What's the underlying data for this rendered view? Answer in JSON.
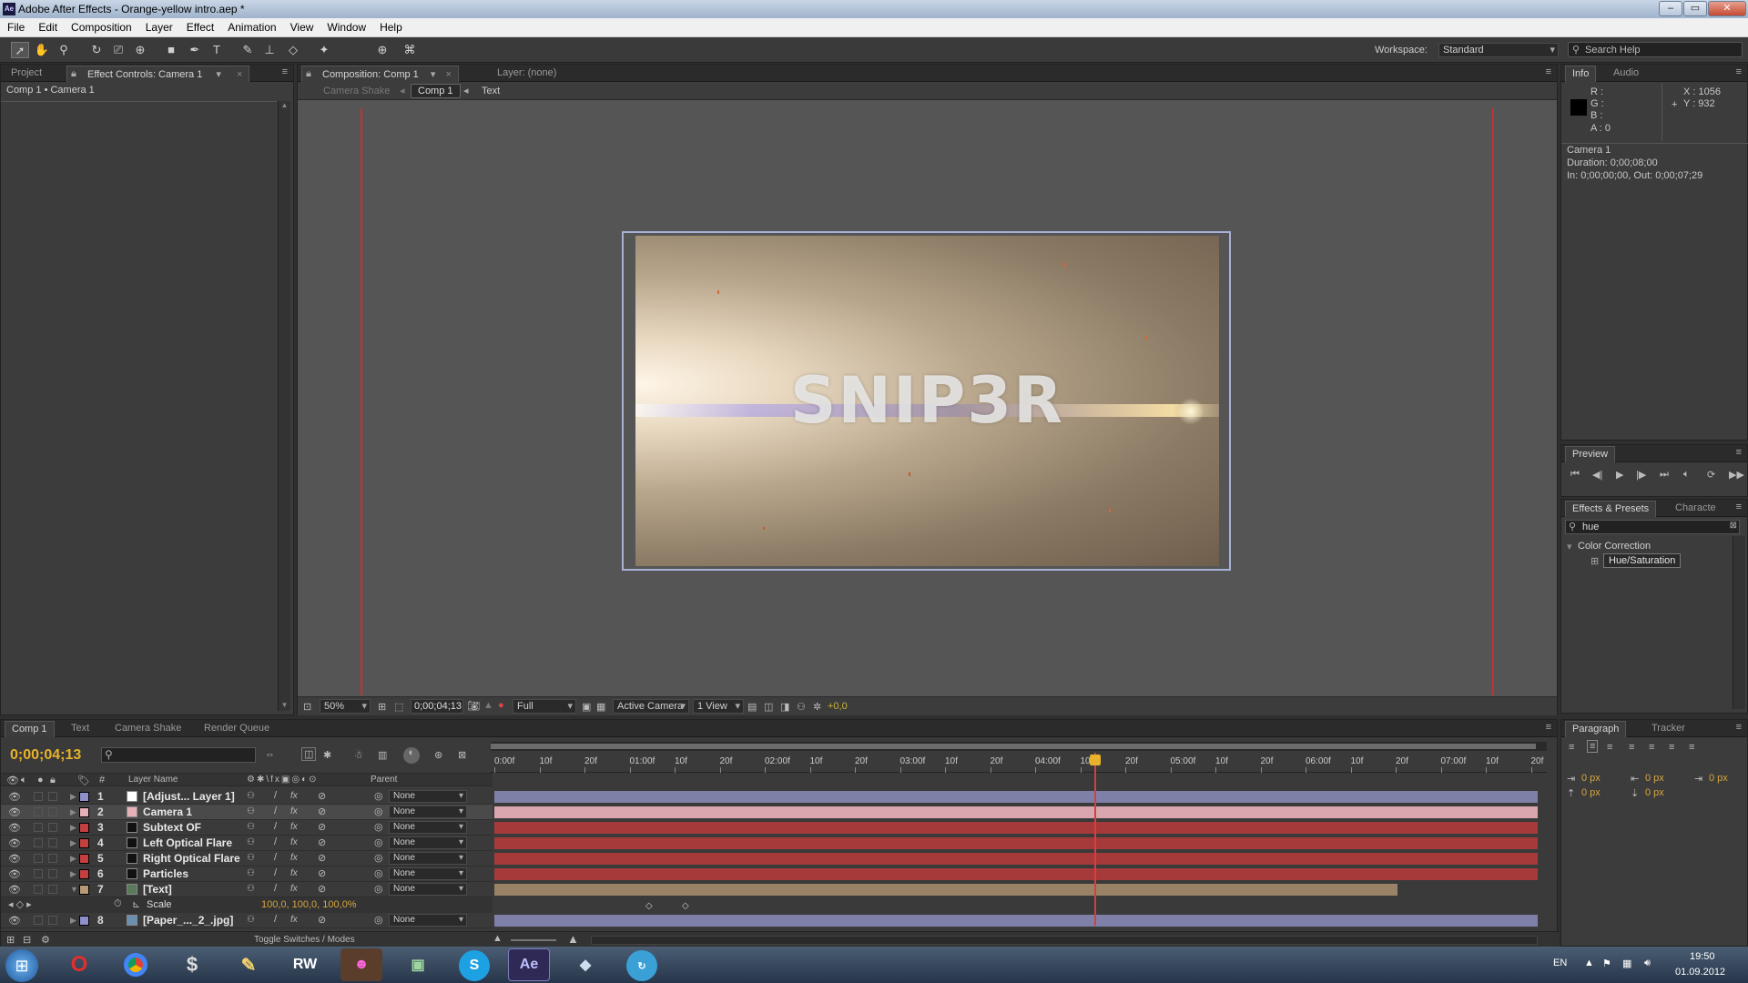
{
  "window": {
    "title": "Adobe After Effects - Orange-yellow intro.aep *",
    "app_icon": "Ae"
  },
  "menu": [
    "File",
    "Edit",
    "Composition",
    "Layer",
    "Effect",
    "Animation",
    "View",
    "Window",
    "Help"
  ],
  "workspace": {
    "label": "Workspace:",
    "value": "Standard"
  },
  "search_help": {
    "placeholder": "Search Help"
  },
  "left_panel": {
    "tabs": [
      "Project",
      "Effect Controls: Camera 1"
    ],
    "breadcrumb": "Comp 1 • Camera 1"
  },
  "comp_panel": {
    "tabs": [
      "Composition: Comp 1",
      "Layer: (none)"
    ],
    "flow": [
      "Camera Shake",
      "Comp 1",
      "Text"
    ],
    "title_text": "SNIP3R",
    "footer": {
      "zoom": "50%",
      "timecode": "0;00;04;13",
      "resolution": "Full",
      "camera": "Active Camera",
      "views": "1 View",
      "exposure": "+0,0"
    }
  },
  "info_panel": {
    "tabs": [
      "Info",
      "Audio"
    ],
    "r": "R :",
    "g": "G :",
    "b": "B :",
    "a": "A : 0",
    "x": "X : 1056",
    "y": "Y : 932",
    "layer": "Camera 1",
    "duration": "Duration: 0;00;08;00",
    "inout": "In: 0;00;00;00, Out: 0;00;07;29"
  },
  "preview_panel": {
    "tab": "Preview"
  },
  "effects_panel": {
    "tabs": [
      "Effects & Presets",
      "Characte"
    ],
    "search_value": "hue",
    "category": "Color Correction",
    "item": "Hue/Saturation"
  },
  "paragraph_panel": {
    "tabs": [
      "Paragraph",
      "Tracker"
    ],
    "values": [
      "0 px",
      "0 px",
      "0 px",
      "0 px",
      "0 px"
    ]
  },
  "timeline": {
    "tabs": [
      "Comp 1",
      "Text",
      "Camera Shake",
      "Render Queue"
    ],
    "timecode": "0;00;04;13",
    "col_num": "#",
    "col_layer": "Layer Name",
    "col_parent": "Parent",
    "toggle": "Toggle Switches / Modes",
    "ruler": [
      "0:00f",
      "10f",
      "20f",
      "01:00f",
      "10f",
      "20f",
      "02:00f",
      "10f",
      "20f",
      "03:00f",
      "10f",
      "20f",
      "04:00f",
      "10f",
      "20f",
      "05:00f",
      "10f",
      "20f",
      "06:00f",
      "10f",
      "20f",
      "07:00f",
      "10f",
      "20f"
    ],
    "layers": [
      {
        "num": "1",
        "name": "[Adjust... Layer 1]",
        "color": "#ffffff",
        "label": "#8f8fc9",
        "parent": "None",
        "bar": "#7f80a8"
      },
      {
        "num": "2",
        "name": "Camera 1",
        "color": "#e6b0b8",
        "label": "#e6b0b8",
        "parent": "None",
        "bar": "#d9a6ad"
      },
      {
        "num": "3",
        "name": "Subtext OF",
        "color": "#111111",
        "label": "#c44040",
        "parent": "None",
        "bar": "#a63a3a"
      },
      {
        "num": "4",
        "name": "Left Optical Flare",
        "color": "#111111",
        "label": "#c44040",
        "parent": "None",
        "bar": "#a63a3a"
      },
      {
        "num": "5",
        "name": "Right Optical Flare",
        "color": "#111111",
        "label": "#c44040",
        "parent": "None",
        "bar": "#a63a3a"
      },
      {
        "num": "6",
        "name": "Particles",
        "color": "#111111",
        "label": "#c44040",
        "parent": "None",
        "bar": "#a63a3a"
      },
      {
        "num": "7",
        "name": "[Text]",
        "color": "#5a7a5a",
        "label": "#b89a78",
        "parent": "None",
        "bar": "#9a8266"
      },
      {
        "num": "8",
        "name": "[Paper_..._2_.jpg]",
        "color": "#6b8fb0",
        "label": "#8f8fc9",
        "parent": "None",
        "bar": "#7f80a8"
      }
    ],
    "scale": {
      "label": "Scale",
      "value": "100,0, 100,0, 100,0%"
    }
  },
  "taskbar": {
    "lang": "EN",
    "time": "19:50",
    "date": "01.09.2012",
    "apps": [
      "Opera",
      "Chrome",
      "Steam",
      "Paint",
      "RW",
      "Game",
      "Terminal",
      "Skype",
      "Ae",
      "Media",
      "Updater"
    ]
  }
}
